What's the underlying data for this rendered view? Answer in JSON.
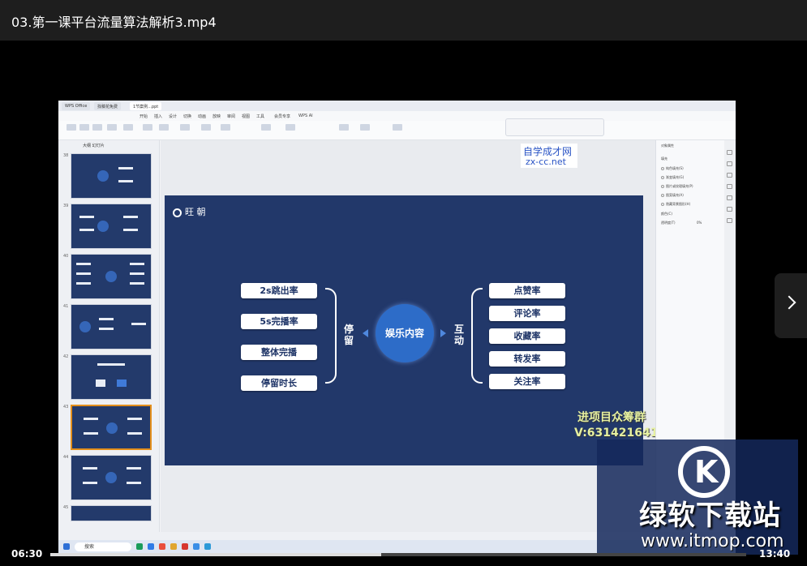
{
  "player": {
    "title": "03.第一课平台流量算法解析3.mp4",
    "current_time": "06:30",
    "total_time": "13:40",
    "progress": 0.476
  },
  "ppt": {
    "tabs": [
      "WPS Office",
      "找稿花免费",
      "1节案例...ppt"
    ],
    "menu": [
      "开始",
      "插入",
      "设计",
      "切换",
      "动画",
      "放映",
      "审阅",
      "视图",
      "工具",
      "会员专享",
      "WPS AI"
    ],
    "thumb_header": "大纲  幻灯片",
    "thumb_numbers": [
      "38",
      "39",
      "40",
      "41",
      "42",
      "43",
      "44",
      "45"
    ],
    "watermark_cn": "自学成才网",
    "watermark_en": "zx-cc.net"
  },
  "slide": {
    "logo": "旺 朝",
    "left_items": [
      "2s跳出率",
      "5s完播率",
      "整体完播",
      "停留时长"
    ],
    "left_label": "停留",
    "center": "娱乐内容",
    "right_label": "互动",
    "right_items": [
      "点赞率",
      "评论率",
      "收藏率",
      "转发率",
      "关注率"
    ]
  },
  "ad": {
    "line1": "进项目众筹群",
    "line2": "V:631421641"
  },
  "right_panel": {
    "title": "对象属性",
    "fill": "填充",
    "options": [
      "纯色填充(S)",
      "渐变填充(G)",
      "图片或纹理填充(P)",
      "图案填充(A)",
      "隐藏背景图形(H)"
    ],
    "color_label": "颜色(C)",
    "transparency_label": "透明度(T)",
    "transparency_value": "0%"
  },
  "taskbar": {
    "search": "搜索"
  },
  "brand": {
    "title": "绿软下载站",
    "url": "www.itmop.com"
  }
}
